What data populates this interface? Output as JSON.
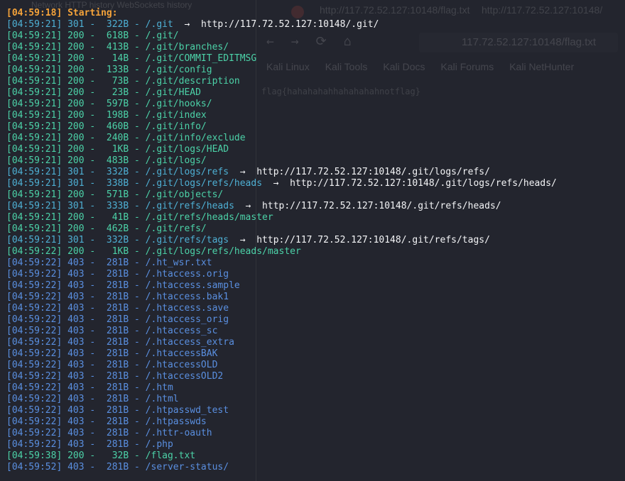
{
  "background_window": {
    "tabs": [
      "http://117.72.52.127:10148/flag.txt",
      "http://117.72.52.127:10148/"
    ],
    "url": "117.72.52.127:10148/flag.txt",
    "bookmarks": [
      "Kali Linux",
      "Kali Tools",
      "Kali Docs",
      "Kali Forums",
      "Kali NetHunter"
    ],
    "page_text": "flag{hahahahahhahahahahnotflag}",
    "left_panel_tabs": [
      "Network",
      "HTTP history",
      "WebSockets history"
    ]
  },
  "terminal": {
    "start": {
      "time": "[04:59:18]",
      "text": "Starting:"
    },
    "lines": [
      {
        "time": "[04:59:21]",
        "code": "301",
        "size": "322B",
        "path": "/.git",
        "redirect": "http://117.72.52.127:10148/.git/"
      },
      {
        "time": "[04:59:21]",
        "code": "200",
        "size": "618B",
        "path": "/.git/",
        "redirect": ""
      },
      {
        "time": "[04:59:21]",
        "code": "200",
        "size": "413B",
        "path": "/.git/branches/",
        "redirect": ""
      },
      {
        "time": "[04:59:21]",
        "code": "200",
        "size": "14B",
        "path": "/.git/COMMIT_EDITMSG",
        "redirect": ""
      },
      {
        "time": "[04:59:21]",
        "code": "200",
        "size": "133B",
        "path": "/.git/config",
        "redirect": ""
      },
      {
        "time": "[04:59:21]",
        "code": "200",
        "size": "73B",
        "path": "/.git/description",
        "redirect": ""
      },
      {
        "time": "[04:59:21]",
        "code": "200",
        "size": "23B",
        "path": "/.git/HEAD",
        "redirect": ""
      },
      {
        "time": "[04:59:21]",
        "code": "200",
        "size": "597B",
        "path": "/.git/hooks/",
        "redirect": ""
      },
      {
        "time": "[04:59:21]",
        "code": "200",
        "size": "198B",
        "path": "/.git/index",
        "redirect": ""
      },
      {
        "time": "[04:59:21]",
        "code": "200",
        "size": "460B",
        "path": "/.git/info/",
        "redirect": ""
      },
      {
        "time": "[04:59:21]",
        "code": "200",
        "size": "240B",
        "path": "/.git/info/exclude",
        "redirect": ""
      },
      {
        "time": "[04:59:21]",
        "code": "200",
        "size": "1KB",
        "path": "/.git/logs/HEAD",
        "redirect": ""
      },
      {
        "time": "[04:59:21]",
        "code": "200",
        "size": "483B",
        "path": "/.git/logs/",
        "redirect": ""
      },
      {
        "time": "[04:59:21]",
        "code": "301",
        "size": "332B",
        "path": "/.git/logs/refs",
        "redirect": "http://117.72.52.127:10148/.git/logs/refs/"
      },
      {
        "time": "[04:59:21]",
        "code": "301",
        "size": "338B",
        "path": "/.git/logs/refs/heads",
        "redirect": "http://117.72.52.127:10148/.git/logs/refs/heads/"
      },
      {
        "time": "[04:59:21]",
        "code": "200",
        "size": "571B",
        "path": "/.git/objects/",
        "redirect": ""
      },
      {
        "time": "[04:59:21]",
        "code": "301",
        "size": "333B",
        "path": "/.git/refs/heads",
        "redirect": "http://117.72.52.127:10148/.git/refs/heads/"
      },
      {
        "time": "[04:59:21]",
        "code": "200",
        "size": "41B",
        "path": "/.git/refs/heads/master",
        "redirect": ""
      },
      {
        "time": "[04:59:21]",
        "code": "200",
        "size": "462B",
        "path": "/.git/refs/",
        "redirect": ""
      },
      {
        "time": "[04:59:21]",
        "code": "301",
        "size": "332B",
        "path": "/.git/refs/tags",
        "redirect": "http://117.72.52.127:10148/.git/refs/tags/"
      },
      {
        "time": "[04:59:22]",
        "code": "200",
        "size": "1KB",
        "path": "/.git/logs/refs/heads/master",
        "redirect": ""
      },
      {
        "time": "[04:59:22]",
        "code": "403",
        "size": "281B",
        "path": "/.ht_wsr.txt",
        "redirect": ""
      },
      {
        "time": "[04:59:22]",
        "code": "403",
        "size": "281B",
        "path": "/.htaccess.orig",
        "redirect": ""
      },
      {
        "time": "[04:59:22]",
        "code": "403",
        "size": "281B",
        "path": "/.htaccess.sample",
        "redirect": ""
      },
      {
        "time": "[04:59:22]",
        "code": "403",
        "size": "281B",
        "path": "/.htaccess.bak1",
        "redirect": ""
      },
      {
        "time": "[04:59:22]",
        "code": "403",
        "size": "281B",
        "path": "/.htaccess.save",
        "redirect": ""
      },
      {
        "time": "[04:59:22]",
        "code": "403",
        "size": "281B",
        "path": "/.htaccess_orig",
        "redirect": ""
      },
      {
        "time": "[04:59:22]",
        "code": "403",
        "size": "281B",
        "path": "/.htaccess_sc",
        "redirect": ""
      },
      {
        "time": "[04:59:22]",
        "code": "403",
        "size": "281B",
        "path": "/.htaccess_extra",
        "redirect": ""
      },
      {
        "time": "[04:59:22]",
        "code": "403",
        "size": "281B",
        "path": "/.htaccessBAK",
        "redirect": ""
      },
      {
        "time": "[04:59:22]",
        "code": "403",
        "size": "281B",
        "path": "/.htaccessOLD",
        "redirect": ""
      },
      {
        "time": "[04:59:22]",
        "code": "403",
        "size": "281B",
        "path": "/.htaccessOLD2",
        "redirect": ""
      },
      {
        "time": "[04:59:22]",
        "code": "403",
        "size": "281B",
        "path": "/.htm",
        "redirect": ""
      },
      {
        "time": "[04:59:22]",
        "code": "403",
        "size": "281B",
        "path": "/.html",
        "redirect": ""
      },
      {
        "time": "[04:59:22]",
        "code": "403",
        "size": "281B",
        "path": "/.htpasswd_test",
        "redirect": ""
      },
      {
        "time": "[04:59:22]",
        "code": "403",
        "size": "281B",
        "path": "/.htpasswds",
        "redirect": ""
      },
      {
        "time": "[04:59:22]",
        "code": "403",
        "size": "281B",
        "path": "/.httr-oauth",
        "redirect": ""
      },
      {
        "time": "[04:59:22]",
        "code": "403",
        "size": "281B",
        "path": "/.php",
        "redirect": ""
      },
      {
        "time": "[04:59:38]",
        "code": "200",
        "size": "32B",
        "path": "/flag.txt",
        "redirect": ""
      },
      {
        "time": "[04:59:52]",
        "code": "403",
        "size": "281B",
        "path": "/server-status/",
        "redirect": ""
      }
    ]
  },
  "colors": {
    "status_301": "#4eb0d4",
    "status_200": "#4cd2a8",
    "status_403": "#5a8fe0",
    "starting": "#f5a33a",
    "background": "#23252e"
  }
}
